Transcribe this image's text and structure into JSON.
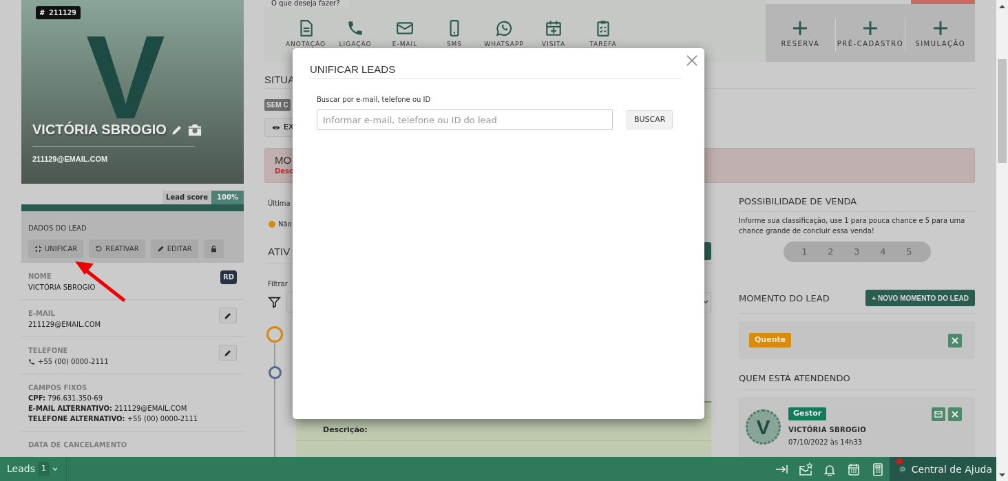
{
  "lead_card": {
    "id_badge": "# 211129",
    "initial": "V",
    "name": "VICTÓRIA SBROGIO",
    "email": "211129@EMAIL.COM",
    "score_label": "Lead score",
    "score_value": "100%",
    "level": 1
  },
  "lead_data": {
    "title": "DADOS DO LEAD",
    "actions": [
      {
        "kind": "unify",
        "label": "UNIFICAR"
      },
      {
        "kind": "reactivate",
        "label": "REATIVAR"
      },
      {
        "kind": "edit",
        "label": "EDITAR"
      },
      {
        "kind": "lock"
      }
    ],
    "fields": [
      {
        "kind": "text",
        "label": "NOME",
        "value": "VICTÓRIA SBROGIO",
        "badge": "RD",
        "editable": false
      },
      {
        "kind": "text",
        "label": "E-MAIL",
        "value": "211129@EMAIL.COM",
        "editable": true
      },
      {
        "kind": "phone",
        "label": "TELEFONE",
        "value": "+55 (00) 0000-2111",
        "editable": true
      },
      {
        "kind": "lines",
        "label": "CAMPOS FIXOS",
        "lines": [
          "**CPF:** 796.631.350-69",
          "**E-MAIL ALTERNATIVO:** 211129@EMAIL.COM",
          "**TELEFONE ALTERNATIVO:** +55 (00) 0000-2111"
        ],
        "editable": false
      },
      {
        "kind": "text",
        "label": "DATA DE CANCELAMENTO",
        "editable": false
      }
    ]
  },
  "actions_bar": {
    "prompt": "O que deseja fazer?",
    "items": [
      {
        "kind": "note",
        "label": "ANOTAÇÃO"
      },
      {
        "kind": "call",
        "label": "LIGAÇÃO"
      },
      {
        "kind": "email",
        "label": "E-MAIL"
      },
      {
        "kind": "sms",
        "label": "SMS"
      },
      {
        "kind": "whatsapp",
        "label": "WHATSAPP"
      },
      {
        "kind": "visit",
        "label": "VISITA"
      },
      {
        "kind": "task",
        "label": "TAREFA"
      }
    ],
    "quick_add": [
      {
        "label": "RESERVA"
      },
      {
        "label": "PRÉ-CADASTRO"
      },
      {
        "label": "SIMULAÇÃO"
      }
    ]
  },
  "situation": {
    "heading": "SITUA",
    "status_badge": "SEM C",
    "view_button": "EX"
  },
  "alert": {
    "title": "MO",
    "text": "Desc"
  },
  "last_contact": {
    "label": "Última",
    "status": "Não",
    "color": "#d98a0a"
  },
  "activities": {
    "heading": "ATIV",
    "filter_label": "Filtrar",
    "timeline": [
      {
        "color": "#d98a0a"
      },
      {
        "color": "#55688f"
      }
    ],
    "card_label": "Descrição:"
  },
  "sale_chance": {
    "title": "POSSIBILIDADE DE VENDA",
    "hint": "Informe sua classificação, use 1 para pouca chance e 5 para uma chance grande de concluir essa venda!",
    "options": [
      {
        "label": "1",
        "selected": false
      },
      {
        "label": "2",
        "selected": false
      },
      {
        "label": "3",
        "selected": false
      },
      {
        "label": "4",
        "selected": false
      },
      {
        "label": "5",
        "selected": false
      }
    ]
  },
  "lead_moment": {
    "title": "MOMENTO DO LEAD",
    "add_button": "+ NOVO MOMENTO DO LEAD",
    "tags": [
      {
        "label": "Quente",
        "color": "#d98b0b"
      }
    ]
  },
  "attendants": {
    "title": "QUEM ESTÁ ATENDENDO",
    "items": [
      {
        "initial": "V",
        "role": "Gestor",
        "name": "VICTÓRIA SBROGIO",
        "date": "07/10/2022 às 14h33"
      }
    ]
  },
  "modal": {
    "title": "UNIFICAR LEADS",
    "search_label": "Buscar por e-mail, telefone ou ID",
    "placeholder": "Informar e-mail, telefone ou ID do lead",
    "button": "BUSCAR"
  },
  "bottom_bar": {
    "tab_label": "Leads",
    "tab_count": "1",
    "help": "Central de Ajuda",
    "help_notification": true
  }
}
